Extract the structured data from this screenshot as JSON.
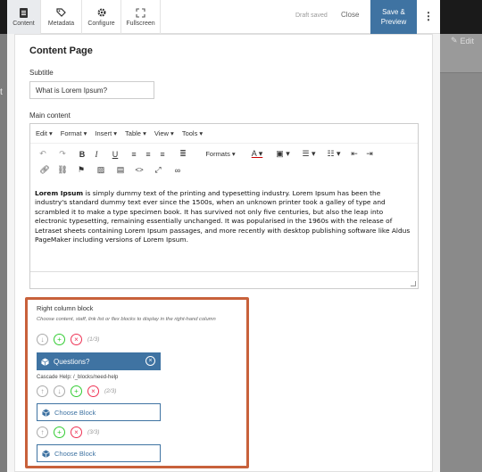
{
  "toolbar": {
    "tabs": [
      {
        "label": "Content",
        "icon": "content-icon"
      },
      {
        "label": "Metadata",
        "icon": "tag-icon"
      },
      {
        "label": "Configure",
        "icon": "gear-icon"
      },
      {
        "label": "Fullscreen",
        "icon": "fullscreen-icon"
      }
    ],
    "draft_status": "Draft saved",
    "close_label": "Close",
    "save_line1": "Save &",
    "save_line2": "Preview",
    "more": "⋮"
  },
  "background": {
    "edit_label": "Edit",
    "left_letter": "t"
  },
  "page": {
    "title": "Content Page",
    "subtitle_label": "Subtitle",
    "subtitle_value": "What is Lorem Ipsum?",
    "main_label": "Main content"
  },
  "editor": {
    "menus": [
      "Edit",
      "Format",
      "Insert",
      "Table",
      "View",
      "Tools"
    ],
    "formats_label": "Formats",
    "body_bold": "Lorem Ipsum",
    "body_text": " is simply dummy text of the printing and typesetting industry. Lorem Ipsum has been the industry's standard dummy text ever since the 1500s, when an unknown printer took a galley of type and scrambled it to make a type specimen book. It has survived not only five centuries, but also the leap into electronic typesetting, remaining essentially unchanged. It was popularised in the 1960s with the release of Letraset sheets containing Lorem Ipsum passages, and more recently with desktop publishing software like Aldus PageMaker including versions of Lorem Ipsum."
  },
  "right_column": {
    "title": "Right column block",
    "hint": "Choose content, staff, link list or flex blocks to display in the right-hand column",
    "counter1": "(1/3)",
    "counter2": "(2/3)",
    "counter3": "(3/3)",
    "selected_block": "Questions?",
    "path": "Cascade Help: /_blocks/need-help",
    "choose_label": "Choose Block"
  },
  "colors": {
    "accent": "#3f73a2",
    "highlight": "#c8613b",
    "add": "#33cc33",
    "remove": "#ee3355"
  }
}
